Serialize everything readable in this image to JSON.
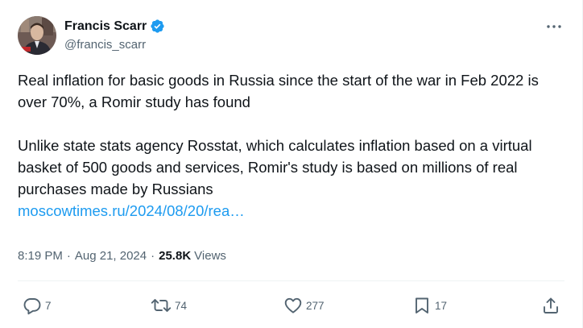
{
  "author": {
    "display_name": "Francis Scarr",
    "handle": "@francis_scarr",
    "verified": true
  },
  "tweet": {
    "paragraph1": "Real inflation for basic goods in Russia since the start of the war in Feb 2022 is over 70%, a Romir study has found",
    "paragraph2": "Unlike state stats agency Rosstat, which calculates inflation based on a virtual basket of 500 goods and services, Romir's study is based on millions of real purchases made by Russians",
    "link_text": "moscowtimes.ru/2024/08/20/rea…"
  },
  "meta": {
    "time": "8:19 PM",
    "separator": "·",
    "date": "Aug 21, 2024",
    "views_count": "25.8K",
    "views_label": "Views"
  },
  "actions": {
    "replies": "7",
    "reposts": "74",
    "likes": "277",
    "bookmarks": "17"
  },
  "colors": {
    "text": "#0f1419",
    "secondary": "#536471",
    "link": "#1d9bf0",
    "verified": "#1d9bf0",
    "divider": "#eff3f4"
  },
  "icons": {
    "more": "more-horizontal-icon",
    "reply": "reply-icon",
    "repost": "repost-icon",
    "like": "heart-icon",
    "bookmark": "bookmark-icon",
    "share": "share-icon"
  }
}
